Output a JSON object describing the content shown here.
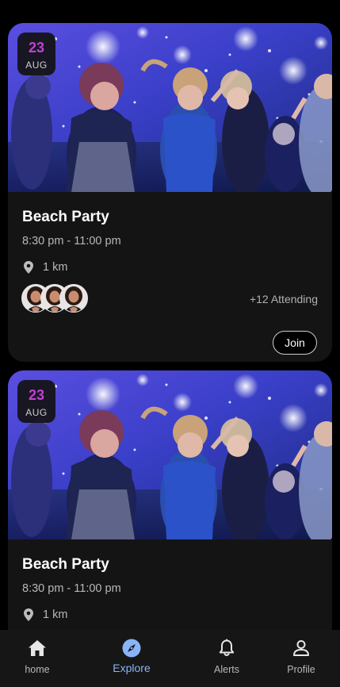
{
  "events": [
    {
      "day": "23",
      "month": "AUG",
      "title": "Beach Party",
      "time": "8:30 pm - 11:00 pm",
      "distance": "1 km",
      "attending": "+12 Attending",
      "join_label": "Join"
    },
    {
      "day": "23",
      "month": "AUG",
      "title": "Beach Party",
      "time": "8:30 pm - 11:00 pm",
      "distance": "1 km"
    }
  ],
  "nav": {
    "items": [
      {
        "label": "home",
        "icon": "home-icon"
      },
      {
        "label": "Explore",
        "icon": "compass-icon",
        "active": true
      },
      {
        "label": "Alerts",
        "icon": "bell-icon"
      },
      {
        "label": "Profile",
        "icon": "person-icon"
      }
    ]
  },
  "colors": {
    "background": "#000000",
    "card": "#141414",
    "date_day": "#c33fd6",
    "active_nav": "#8ab4f8",
    "muted_text": "#b8b8b8"
  }
}
